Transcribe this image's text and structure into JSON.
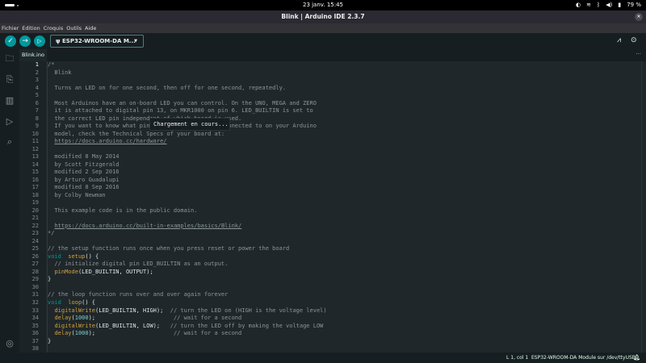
{
  "system": {
    "clock": "23 janv.  15:45",
    "battery": "79 %"
  },
  "window": {
    "title": "Blink | Arduino IDE 2.3.7",
    "close": "×"
  },
  "menu": [
    "Fichier",
    "Edition",
    "Croquis",
    "Outils",
    "Aide"
  ],
  "toolbar": {
    "board": "ESP32-WROOM-DA M...",
    "verify": "✓",
    "upload": "→",
    "debug": "▷"
  },
  "tab": {
    "label": "Blink.ino",
    "more": "···"
  },
  "tooltip": "Chargement en cours...",
  "status": {
    "position": "L 1, col 1",
    "board": "ESP32-WROOM-DA Module sur /dev/ttyUSB0"
  },
  "code": [
    [
      [
        "c",
        "/*"
      ]
    ],
    [
      [
        "c",
        "  Blink"
      ]
    ],
    [],
    [
      [
        "c",
        "  Turns an LED on for one second, then off for one second, repeatedly."
      ]
    ],
    [],
    [
      [
        "c",
        "  Most Arduinos have an on-board LED you can control. On the UNO, MEGA and ZERO"
      ]
    ],
    [
      [
        "c",
        "  it is attached to digital pin 13, on MKR1000 on pin 6. LED_BUILTIN is set to"
      ]
    ],
    [
      [
        "c",
        "  the correct LED pin independent of which board is used."
      ]
    ],
    [
      [
        "c",
        "  If you want to know what pin the on-board LED is connected to on your Arduino"
      ]
    ],
    [
      [
        "c",
        "  model, check the Technical Specs of your board at:"
      ]
    ],
    [
      [
        "c",
        "  "
      ],
      [
        "u",
        "https://docs.arduino.cc/hardware/"
      ]
    ],
    [],
    [
      [
        "c",
        "  modified 8 May 2014"
      ]
    ],
    [
      [
        "c",
        "  by Scott Fitzgerald"
      ]
    ],
    [
      [
        "c",
        "  modified 2 Sep 2016"
      ]
    ],
    [
      [
        "c",
        "  by Arturo Guadalupi"
      ]
    ],
    [
      [
        "c",
        "  modified 8 Sep 2016"
      ]
    ],
    [
      [
        "c",
        "  by Colby Newman"
      ]
    ],
    [],
    [
      [
        "c",
        "  This example code is in the public domain."
      ]
    ],
    [],
    [
      [
        "c",
        "  "
      ],
      [
        "u",
        "https://docs.arduino.cc/built-in-examples/basics/Blink/"
      ]
    ],
    [
      [
        "c",
        "*/"
      ]
    ],
    [],
    [
      [
        "c",
        "// the setup function runs once when you press reset or power the board"
      ]
    ],
    [
      [
        "k",
        "void"
      ],
      [
        "",
        "  "
      ],
      [
        "f",
        "setup"
      ],
      [
        "",
        "() {"
      ]
    ],
    [
      [
        "c",
        "  // initialize digital pin LED_BUILTIN as an output."
      ]
    ],
    [
      [
        "",
        "  "
      ],
      [
        "f",
        "pinMode"
      ],
      [
        "",
        "(LED_BUILTIN, OUTPUT);"
      ]
    ],
    [
      [
        "",
        "}"
      ]
    ],
    [],
    [
      [
        "c",
        "// the loop function runs over and over again forever"
      ]
    ],
    [
      [
        "k",
        "void"
      ],
      [
        "",
        "  "
      ],
      [
        "f",
        "loop"
      ],
      [
        "",
        "() {"
      ]
    ],
    [
      [
        "",
        "  "
      ],
      [
        "f",
        "digitalWrite"
      ],
      [
        "",
        "(LED_BUILTIN, HIGH);  "
      ],
      [
        "c",
        "// turn the LED on (HIGH is the voltage level)"
      ]
    ],
    [
      [
        "",
        "  "
      ],
      [
        "f",
        "delay"
      ],
      [
        "",
        "("
      ],
      [
        "n",
        "1000"
      ],
      [
        "",
        ");                       "
      ],
      [
        "c",
        "// wait for a second"
      ]
    ],
    [
      [
        "",
        "  "
      ],
      [
        "f",
        "digitalWrite"
      ],
      [
        "",
        "(LED_BUILTIN, LOW);   "
      ],
      [
        "c",
        "// turn the LED off by making the voltage LOW"
      ]
    ],
    [
      [
        "",
        "  "
      ],
      [
        "f",
        "delay"
      ],
      [
        "",
        "("
      ],
      [
        "n",
        "1000"
      ],
      [
        "",
        ");                       "
      ],
      [
        "c",
        "// wait for a second"
      ]
    ],
    [
      [
        "",
        "}"
      ]
    ],
    []
  ]
}
